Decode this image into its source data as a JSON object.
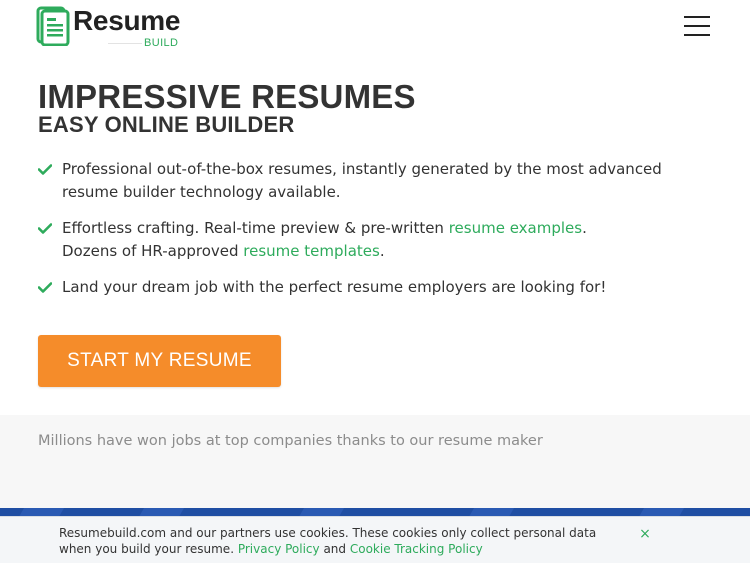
{
  "brand": {
    "name": "Resume",
    "sub": "BUILD",
    "logo_icon": "resume-document-icon",
    "accent_color": "#2eab5c",
    "cta_color": "#f58c2a",
    "footer_band_color": "#1f4ea3"
  },
  "header": {
    "menu_icon": "hamburger-menu-icon"
  },
  "hero": {
    "title": "IMPRESSIVE RESUMES",
    "subtitle": "EASY ONLINE BUILDER",
    "features": [
      {
        "text": "Professional out-of-the-box resumes, instantly generated by the most advanced resume builder technology available."
      },
      {
        "text_before": "Effortless crafting. Real-time preview & pre-written ",
        "link1": "resume examples",
        "text_mid": ".",
        "text_line2": "Dozens of HR-approved ",
        "link2": "resume templates",
        "text_after": "."
      },
      {
        "text": "Land your dream job with the perfect resume employers are looking for!"
      }
    ],
    "cta_label": "START MY RESUME"
  },
  "social_proof": "Millions have won jobs at top companies thanks to our resume maker",
  "cookie_banner": {
    "text": "Resumebuild.com and our partners use cookies. These cookies only collect personal data when you build your resume.",
    "privacy_link": "Privacy Policy",
    "and_text": "and",
    "tracking_link": "Cookie Tracking Policy",
    "close_label": "×"
  }
}
